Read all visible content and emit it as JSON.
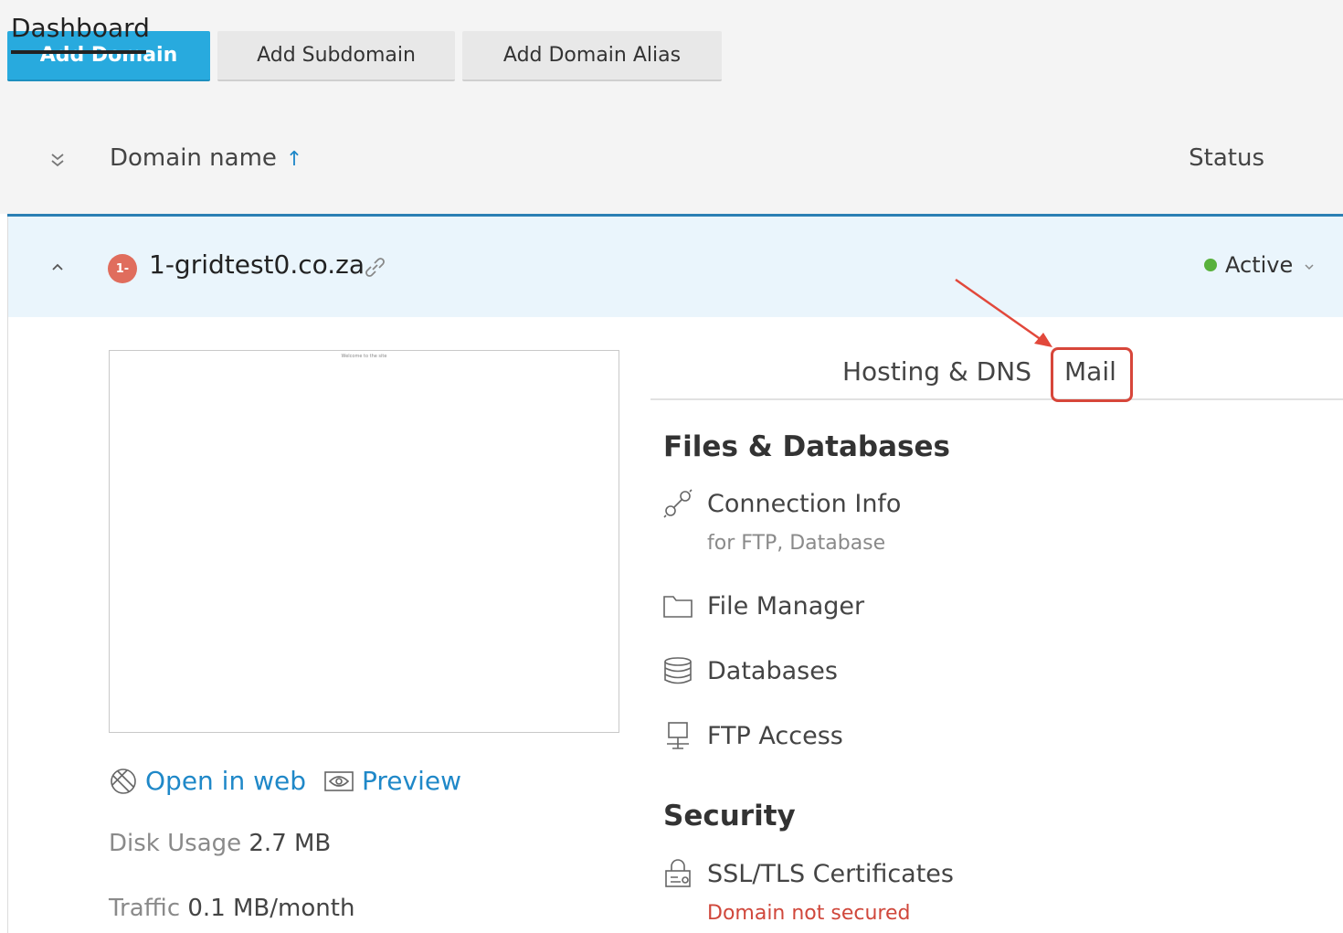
{
  "toolbar": {
    "add_domain": "Add Domain",
    "add_subdomain": "Add Subdomain",
    "add_domain_alias": "Add Domain Alias"
  },
  "table": {
    "col_domain": "Domain name",
    "sort_indicator": "↑",
    "col_status": "Status"
  },
  "domain": {
    "favicon_text": "1-",
    "name": "1-gridtest0.co.za",
    "status": "Active",
    "status_color": "#58b13c",
    "thumbnail_caption": "Welcome to the site",
    "open_in_web": "Open in web",
    "preview": "Preview",
    "disk_usage_label": "Disk Usage",
    "disk_usage_value": "2.7 MB",
    "traffic_label": "Traffic",
    "traffic_value": "0.1 MB/month"
  },
  "tabs": [
    {
      "label": "Dashboard",
      "active": true
    },
    {
      "label": "Hosting & DNS",
      "active": false
    },
    {
      "label": "Mail",
      "active": false,
      "highlighted": true
    }
  ],
  "sections": {
    "files": {
      "title": "Files & Databases",
      "items": [
        {
          "label": "Connection Info",
          "sub": "for FTP, Database",
          "icon": "connection-icon"
        },
        {
          "label": "File Manager",
          "icon": "folder-icon"
        },
        {
          "label": "Databases",
          "icon": "database-icon"
        },
        {
          "label": "FTP Access",
          "icon": "ftp-icon"
        }
      ]
    },
    "security": {
      "title": "Security",
      "items": [
        {
          "label": "SSL/TLS Certificates",
          "sub": "Domain not secured",
          "icon": "lock-certificate-icon"
        }
      ]
    }
  },
  "colors": {
    "primary": "#28aade",
    "link": "#1f88c8",
    "highlight": "#d7463a",
    "row_bg": "#eaf5fc"
  }
}
